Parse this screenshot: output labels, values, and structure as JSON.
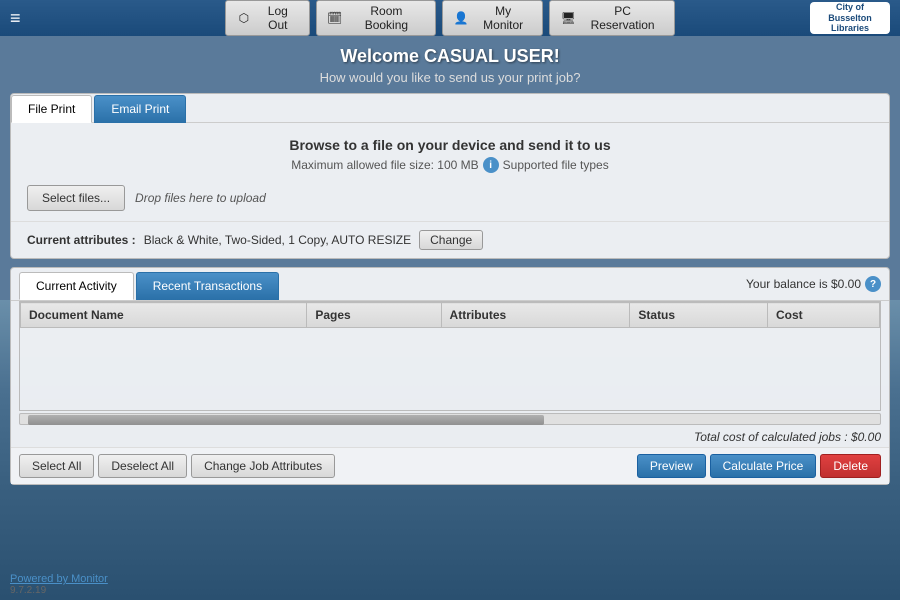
{
  "header": {
    "hamburger": "≡",
    "nav": {
      "logout_label": "Log Out",
      "room_booking_label": "Room Booking",
      "my_monitor_label": "My Monitor",
      "pc_reservation_label": "PC Reservation"
    },
    "logo_line1": "City of Busselton",
    "logo_line2": "Libraries"
  },
  "welcome": {
    "title": "Welcome CASUAL USER!",
    "subtitle": "How would you like to send us your print job?"
  },
  "tabs_upload": {
    "file_print": "File Print",
    "email_print": "Email Print"
  },
  "upload": {
    "title": "Browse to a file on your device and send it to us",
    "subtitle_size": "Maximum allowed file size: 100 MB",
    "subtitle_types": "Supported file types",
    "select_btn": "Select files...",
    "drop_text": "Drop files here to upload"
  },
  "attributes": {
    "label": "Current attributes :",
    "value": "Black & White, Two-Sided, 1 Copy, AUTO RESIZE",
    "change_btn": "Change"
  },
  "activity": {
    "tab_current": "Current Activity",
    "tab_recent": "Recent Transactions",
    "balance_label": "Your balance is $0.00",
    "table": {
      "columns": [
        "Document Name",
        "Pages",
        "Attributes",
        "Status",
        "Cost"
      ],
      "rows": []
    },
    "total_cost": "Total cost of calculated jobs : $0.00"
  },
  "bottom_actions": {
    "select_all": "Select All",
    "deselect_all": "Deselect All",
    "change_job_attributes": "Change Job Attributes",
    "preview": "Preview",
    "calculate_price": "Calculate Price",
    "delete": "Delete"
  },
  "footer": {
    "powered_by": "Powered by Monitor",
    "version": "9.7.2.19"
  }
}
